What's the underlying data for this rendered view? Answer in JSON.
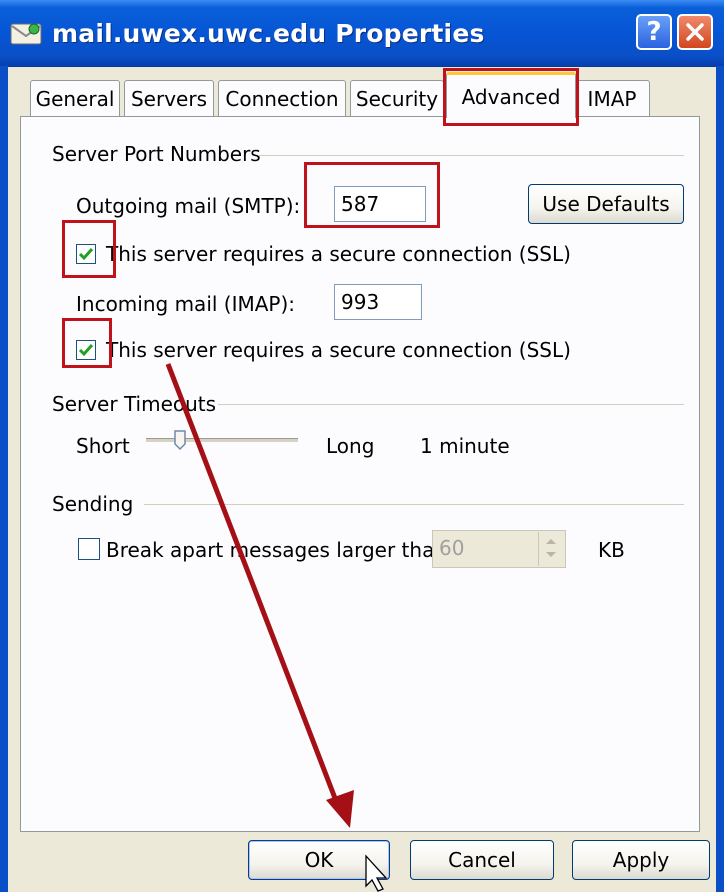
{
  "window": {
    "title": "mail.uwex.uwc.edu Properties",
    "help_label": "?"
  },
  "tabs": [
    {
      "label": "General"
    },
    {
      "label": "Servers"
    },
    {
      "label": "Connection"
    },
    {
      "label": "Security"
    },
    {
      "label": "Advanced"
    },
    {
      "label": "IMAP"
    }
  ],
  "ports": {
    "group_label": "Server Port Numbers",
    "outgoing_label": "Outgoing mail (SMTP):",
    "outgoing_value": "587",
    "use_defaults_label": "Use Defaults",
    "outgoing_ssl_label": "This server requires a secure connection (SSL)",
    "incoming_label": "Incoming mail (IMAP):",
    "incoming_value": "993",
    "incoming_ssl_label": "This server requires a secure connection (SSL)"
  },
  "timeouts": {
    "group_label": "Server Timeouts",
    "short_label": "Short",
    "long_label": "Long",
    "value_text": "1 minute",
    "slider_level": 0.1
  },
  "sending": {
    "group_label": "Sending",
    "break_label": "Break apart messages larger than",
    "break_value": "60",
    "unit": "KB"
  },
  "buttons": {
    "ok": "OK",
    "cancel": "Cancel",
    "apply": "Apply"
  },
  "colors": {
    "titlebar": "#0655d6",
    "annotation": "#c0121b",
    "check": "#21a121"
  }
}
